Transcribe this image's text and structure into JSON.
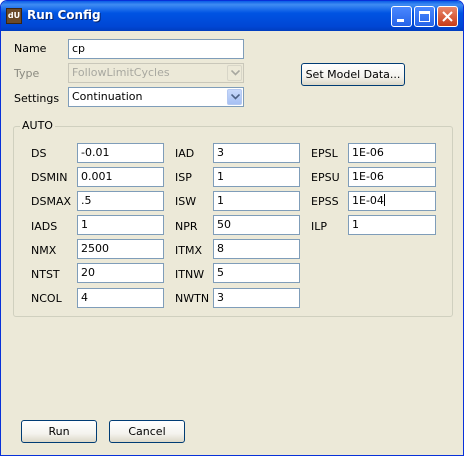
{
  "window": {
    "title": "Run Config",
    "icon": "auto-app-icon",
    "icon_text": "dU",
    "controls": [
      "minimize-icon",
      "maximize-icon",
      "close-icon"
    ]
  },
  "form": {
    "name_label": "Name",
    "name_value": "cp",
    "type_label": "Type",
    "type_value": "FollowLimitCycles",
    "settings_label": "Settings",
    "settings_value": "Continuation",
    "set_model_button": "Set Model Data..."
  },
  "auto": {
    "group_title": "AUTO",
    "params": {
      "DS": "-0.01",
      "DSMIN": "0.001",
      "DSMAX": ".5",
      "IADS": "1",
      "NMX": "2500",
      "NTST": "20",
      "NCOL": "4",
      "IAD": "3",
      "ISP": "1",
      "ISW": "1",
      "NPR": "50",
      "ITMX": "8",
      "ITNW": "5",
      "NWTN": "3",
      "EPSL": "1E-06",
      "EPSU": "1E-06",
      "EPSS": "1E-04",
      "ILP": "1"
    },
    "labels": {
      "DS": "DS",
      "DSMIN": "DSMIN",
      "DSMAX": "DSMAX",
      "IADS": "IADS",
      "NMX": "NMX",
      "NTST": "NTST",
      "NCOL": "NCOL",
      "IAD": "IAD",
      "ISP": "ISP",
      "ISW": "ISW",
      "NPR": "NPR",
      "ITMX": "ITMX",
      "ITNW": "ITNW",
      "NWTN": "NWTN",
      "EPSL": "EPSL",
      "EPSU": "EPSU",
      "EPSS": "EPSS",
      "ILP": "ILP"
    }
  },
  "footer": {
    "run_button": "Run",
    "cancel_button": "Cancel"
  }
}
